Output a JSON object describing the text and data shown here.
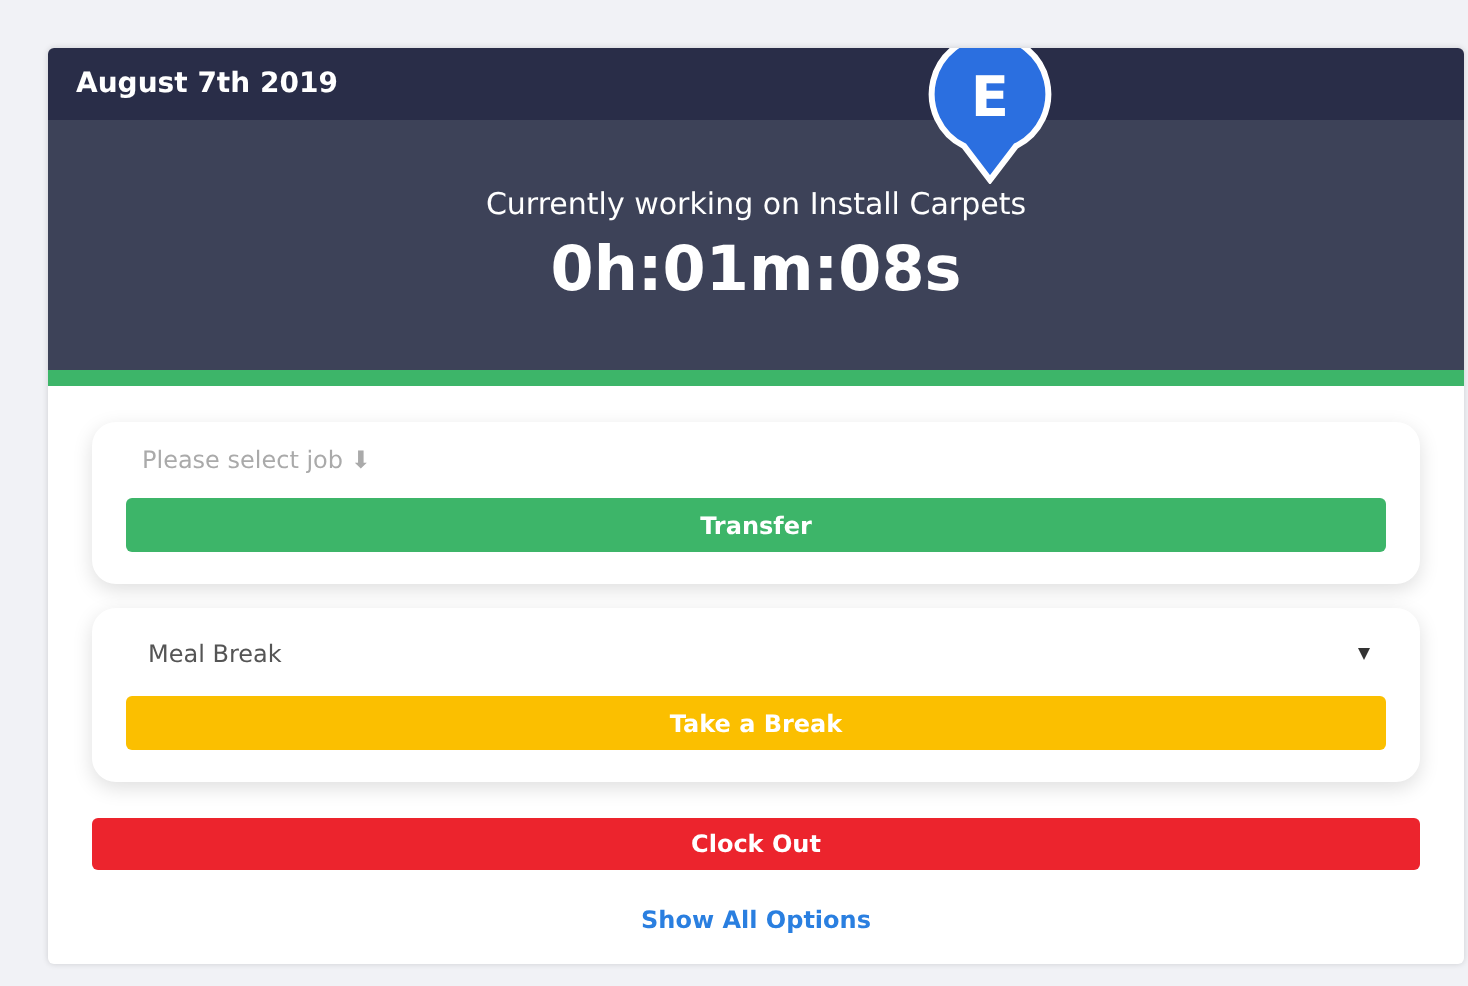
{
  "header": {
    "date": "August 7th 2019"
  },
  "marker": {
    "letter": "E"
  },
  "status": {
    "message": "Currently working on Install Carpets",
    "timer": "0h:01m:08s"
  },
  "job_panel": {
    "placeholder": "Please select job ⬇",
    "button": "Transfer"
  },
  "break_panel": {
    "value": "Meal Break",
    "button": "Take a Break"
  },
  "clock_out": "Clock Out",
  "show_all_link": "Show All Options"
}
